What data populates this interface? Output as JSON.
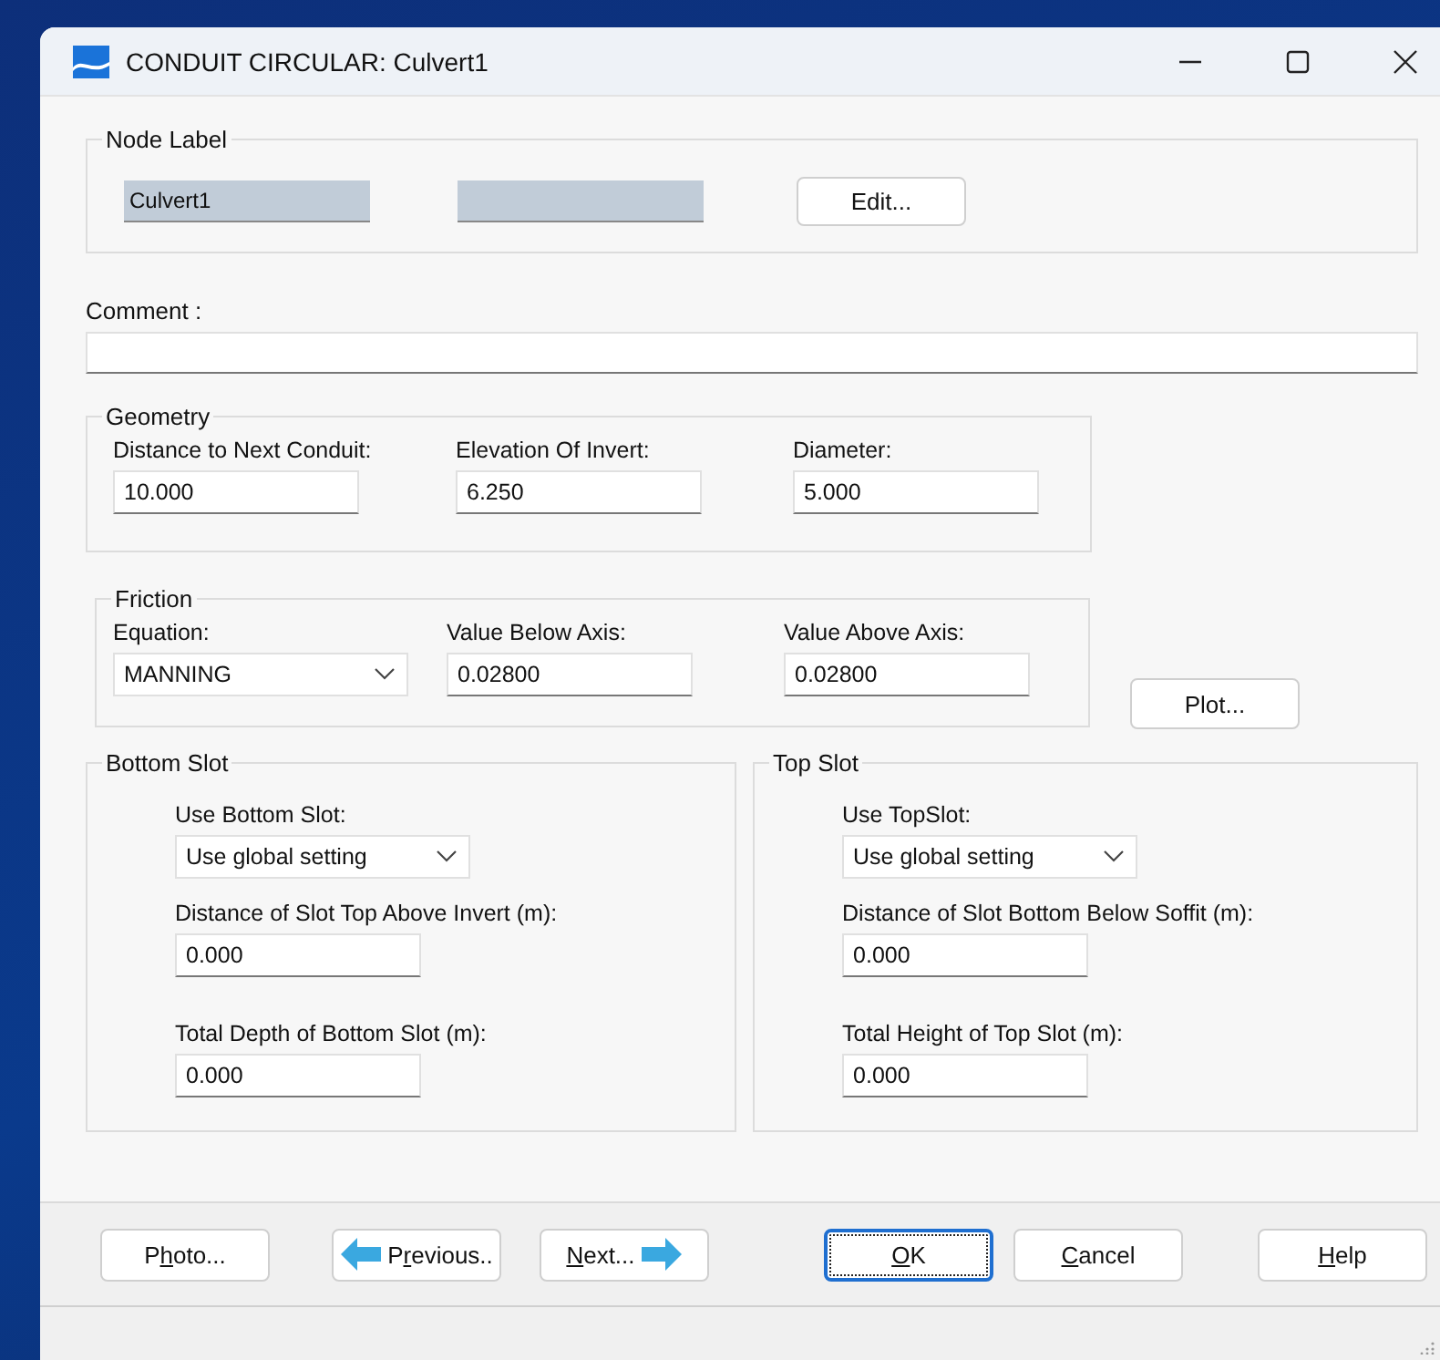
{
  "window": {
    "title": "CONDUIT CIRCULAR: Culvert1"
  },
  "node_label": {
    "legend": "Node Label",
    "value": "Culvert1",
    "edit_button": "Edit..."
  },
  "comment": {
    "label": "Comment :"
  },
  "geometry": {
    "legend": "Geometry",
    "fields": [
      {
        "kind": "text",
        "label": "Distance to Next Conduit:",
        "value": "10.000"
      },
      {
        "kind": "text",
        "label": "Elevation Of Invert:",
        "value": "6.250"
      },
      {
        "kind": "text",
        "label": "Diameter:",
        "value": "5.000"
      }
    ]
  },
  "friction": {
    "legend": "Friction",
    "fields": [
      {
        "kind": "dropdown",
        "label": "Equation:",
        "value": "MANNING"
      },
      {
        "kind": "text",
        "label": "Value Below Axis:",
        "value": "0.02800"
      },
      {
        "kind": "text",
        "label": "Value Above Axis:",
        "value": "0.02800"
      }
    ]
  },
  "plot_button": "Plot...",
  "slots": [
    {
      "legend": "Bottom Slot",
      "use_label": "Use Bottom Slot:",
      "use_value": "Use global setting",
      "fields": [
        {
          "label": "Distance of Slot Top Above Invert (m):",
          "value": "0.000"
        },
        {
          "label": "Total Depth of Bottom Slot (m):",
          "value": "0.000"
        }
      ]
    },
    {
      "legend": "Top Slot",
      "use_label": "Use TopSlot:",
      "use_value": "Use global setting",
      "fields": [
        {
          "label": "Distance of Slot Bottom Below Soffit (m):",
          "value": "0.000"
        },
        {
          "label": "Total Height of Top Slot (m):",
          "value": "0.000"
        }
      ]
    }
  ],
  "buttons": [
    {
      "kind": "plain",
      "before": "P",
      "key": "h",
      "after": "oto...",
      "focused": false
    },
    {
      "kind": "previous",
      "before": "P",
      "key": "r",
      "after": "evious..",
      "focused": false
    },
    {
      "kind": "next",
      "key": "N",
      "after": "ext...",
      "focused": false
    },
    {
      "kind": "plain",
      "key": "O",
      "after": "K",
      "focused": true
    },
    {
      "kind": "plain",
      "key": "C",
      "after": "ancel",
      "focused": false
    },
    {
      "kind": "plain",
      "key": "H",
      "after": "elp",
      "focused": false
    }
  ]
}
